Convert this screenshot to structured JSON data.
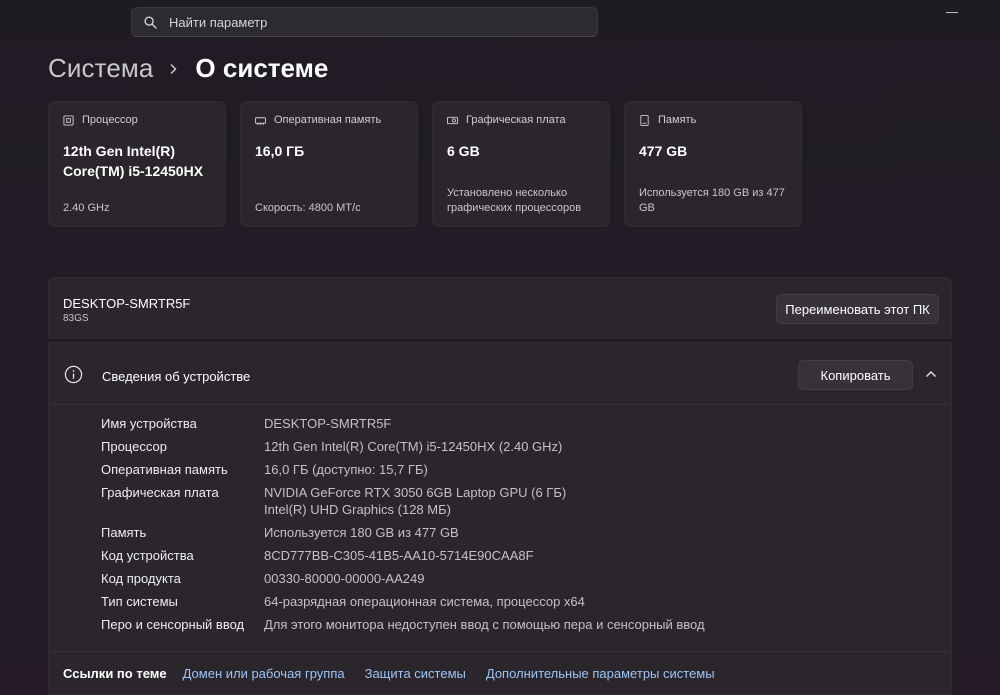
{
  "search": {
    "placeholder": "Найти параметр"
  },
  "breadcrumb": {
    "root": "Система",
    "current": "О системе"
  },
  "cards": [
    {
      "icon": "processor-icon",
      "label": "Процессор",
      "value_line1": "12th Gen Intel(R)",
      "value_line2": "Core(TM) i5-12450HX",
      "sub_line1": "2.40 GHz",
      "sub_line2": ""
    },
    {
      "icon": "ram-icon",
      "label": "Оперативная память",
      "value_line1": "16,0 ГБ",
      "value_line2": "",
      "sub_line1": "Скорость: 4800 MT/c",
      "sub_line2": ""
    },
    {
      "icon": "gpu-icon",
      "label": "Графическая плата",
      "value_line1": "6 GB",
      "value_line2": "",
      "sub_line1": "Установлено несколько",
      "sub_line2": "графических процессоров"
    },
    {
      "icon": "storage-icon",
      "label": "Память",
      "value_line1": "477 GB",
      "value_line2": "",
      "sub_line1": "Используется 180 GB из 477",
      "sub_line2": "GB"
    }
  ],
  "device": {
    "name": "DESKTOP-SMRTR5F",
    "model": "83GS",
    "rename_label": "Переименовать этот ПК"
  },
  "device_info": {
    "title": "Сведения об устройстве",
    "copy_label": "Копировать",
    "rows": [
      {
        "label": "Имя устройства",
        "value": "DESKTOP-SMRTR5F",
        "value2": ""
      },
      {
        "label": "Процессор",
        "value": "12th Gen Intel(R) Core(TM) i5-12450HX (2.40 GHz)",
        "value2": ""
      },
      {
        "label": "Оперативная память",
        "value": "16,0 ГБ (доступно: 15,7 ГБ)",
        "value2": ""
      },
      {
        "label": "Графическая плата",
        "value": "NVIDIA GeForce RTX 3050 6GB Laptop GPU (6 ГБ)",
        "value2": "Intel(R) UHD Graphics (128 МБ)"
      },
      {
        "label": "Память",
        "value": "Используется 180 GB из 477 GB",
        "value2": ""
      },
      {
        "label": "Код устройства",
        "value": "8CD777BB-C305-41B5-AA10-5714E90CAA8F",
        "value2": ""
      },
      {
        "label": "Код продукта",
        "value": "00330-80000-00000-AA249",
        "value2": ""
      },
      {
        "label": "Тип системы",
        "value": "64-разрядная операционная система, процессор x64",
        "value2": ""
      },
      {
        "label": "Перо и сенсорный ввод",
        "value": "Для этого монитора недоступен ввод с помощью пера и сенсорный ввод",
        "value2": ""
      }
    ]
  },
  "related_links": {
    "label": "Ссылки по теме",
    "links": [
      "Домен или рабочая группа",
      "Защита системы",
      "Дополнительные параметры системы"
    ]
  },
  "colors": {
    "background": "#221c26",
    "card": "#2a262c",
    "link": "#9fc3f5"
  }
}
